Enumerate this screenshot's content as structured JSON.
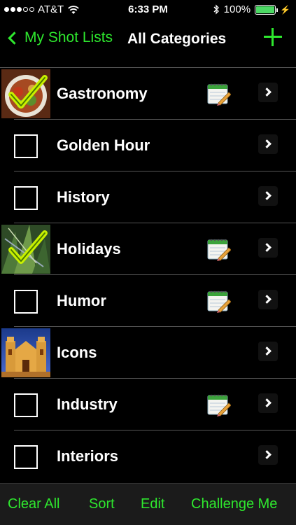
{
  "status_bar": {
    "carrier": "AT&T",
    "time": "6:33 PM",
    "battery": "100%"
  },
  "nav": {
    "back_label": "My Shot Lists",
    "title": "All Categories"
  },
  "categories": [
    {
      "label": "Gastronomy",
      "checked": true,
      "has_notes": true
    },
    {
      "label": "Golden Hour",
      "checked": false,
      "has_notes": false
    },
    {
      "label": "History",
      "checked": false,
      "has_notes": false
    },
    {
      "label": "Holidays",
      "checked": true,
      "has_notes": true
    },
    {
      "label": "Humor",
      "checked": false,
      "has_notes": true
    },
    {
      "label": "Icons",
      "checked": false,
      "has_notes": false,
      "has_photo": true
    },
    {
      "label": "Industry",
      "checked": false,
      "has_notes": true
    },
    {
      "label": "Interiors",
      "checked": false,
      "has_notes": false
    }
  ],
  "toolbar": {
    "clear_all": "Clear All",
    "sort": "Sort",
    "edit": "Edit",
    "challenge": "Challenge Me"
  },
  "colors": {
    "accent": "#2ee82e",
    "background": "#000000",
    "toolbar_bg": "#1b1b1b"
  }
}
